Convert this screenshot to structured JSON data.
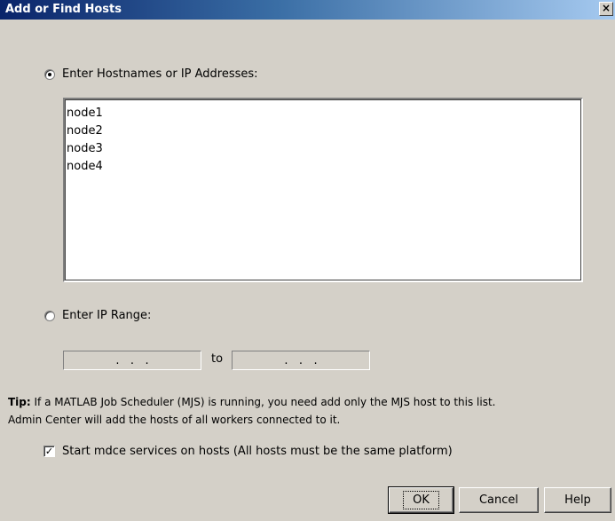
{
  "window": {
    "title": "Add or Find Hosts",
    "close_glyph": "×"
  },
  "hostnames": {
    "radio_label": "Enter Hostnames or IP Addresses:",
    "selected": true,
    "lines": [
      "node1",
      "node2",
      "node3",
      "node4"
    ]
  },
  "ip_range": {
    "radio_label": "Enter IP Range:",
    "selected": false,
    "from_placeholder": ".   .   .",
    "to_label": "to",
    "to_placeholder": ".   .   ."
  },
  "tip": {
    "bold": "Tip:",
    "line1": "If a MATLAB Job Scheduler (MJS) is running, you need add only the MJS host to this list.",
    "line2": "Admin Center will add the hosts of all workers connected to it."
  },
  "checkbox": {
    "label": "Start mdce services on hosts (All hosts must be the same platform)",
    "checked": true,
    "check_glyph": "✓"
  },
  "buttons": {
    "ok": "OK",
    "cancel": "Cancel",
    "help": "Help"
  }
}
